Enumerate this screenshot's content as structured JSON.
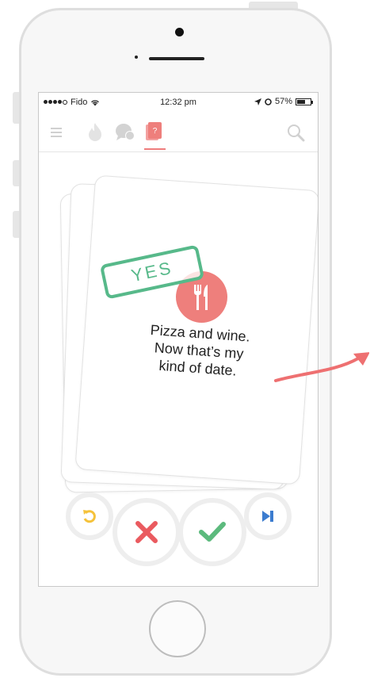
{
  "status_bar": {
    "carrier": "Fido",
    "time": "12:32 pm",
    "battery_percent": "57%",
    "signal_bars_filled": 4,
    "signal_bars_total": 5
  },
  "nav": {
    "icons": [
      "menu-icon",
      "flame-icon",
      "chat-icon",
      "cards-icon",
      "search-icon"
    ],
    "active_tab": "cards-icon",
    "accent_color": "#ef7d7d"
  },
  "card": {
    "text_line1": "Pizza and wine.",
    "text_line2": "Now that’s my",
    "text_line3": "kind of date.",
    "stamp": "YES",
    "stamp_color": "#57b98a",
    "badge_icon": "fork-knife-icon",
    "badge_color": "#ee7f7c"
  },
  "actions": {
    "buttons": [
      "undo-icon",
      "close-icon",
      "check-icon",
      "skip-icon"
    ],
    "colors": {
      "undo": "#f5c23a",
      "nope": "#ea5a5f",
      "like": "#5cba7d",
      "skip": "#3c7ccf"
    }
  },
  "annotation": {
    "arrow_color": "#ee7071"
  }
}
